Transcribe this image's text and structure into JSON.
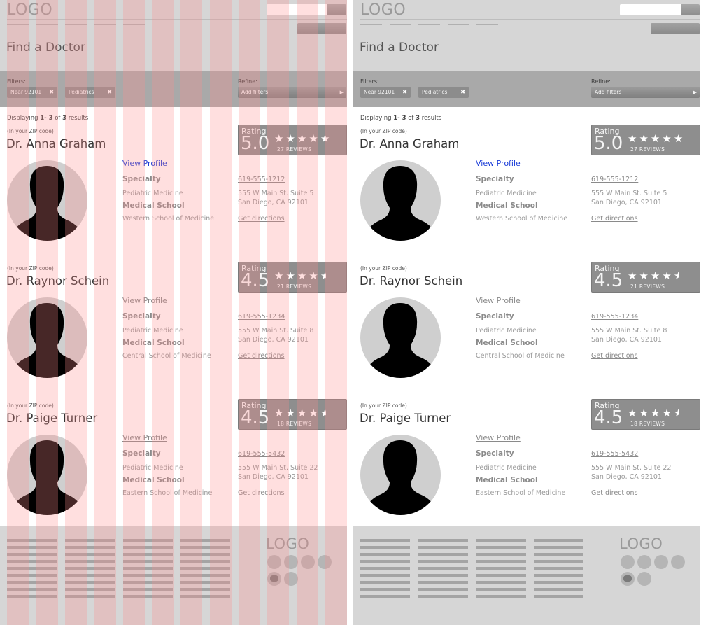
{
  "header": {
    "logo": "LOGO",
    "page_title": "Find a Doctor"
  },
  "filters": {
    "label": "Filters:",
    "chips": [
      {
        "label": "Near 92101",
        "remove": "✖"
      },
      {
        "label": "Pediatrics",
        "remove": "✖"
      }
    ],
    "refine_label": "Refine:",
    "add_filters": "Add filters"
  },
  "results_summary": {
    "prefix": "Displaying",
    "range": "1- 3",
    "of": "of",
    "total": "3",
    "suffix": "results"
  },
  "doctors": [
    {
      "zip_note": "(In your ZIP code)",
      "name": "Dr. Anna Graham",
      "view_profile": "View Profile",
      "specialty_label": "Specialty",
      "specialty": "Pediatric Medicine",
      "school_label": "Medical School",
      "school": "Western School of Medicine",
      "phone": "619-555-1212",
      "address_line1": "555 W Main St. Suite 5",
      "address_line2": "San Diego, CA 92101",
      "directions": "Get directions",
      "rating_label": "Rating",
      "rating": 5.0,
      "rating_text": "5.0",
      "reviews": "27 REVIEWS"
    },
    {
      "zip_note": "(In your ZIP code)",
      "name": "Dr. Raynor Schein",
      "view_profile": "View Profile",
      "specialty_label": "Specialty",
      "specialty": "Pediatric Medicine",
      "school_label": "Medical School",
      "school": "Central School of Medicine",
      "phone": "619-555-1234",
      "address_line1": "555 W Main St. Suite 8",
      "address_line2": "San Diego, CA 92101",
      "directions": "Get directions",
      "rating_label": "Rating",
      "rating": 4.5,
      "rating_text": "4.5",
      "reviews": "21 REVIEWS"
    },
    {
      "zip_note": "(In your ZIP code)",
      "name": "Dr. Paige Turner",
      "view_profile": "View Profile",
      "specialty_label": "Specialty",
      "specialty": "Pediatric Medicine",
      "school_label": "Medical School",
      "school": "Eastern School of Medicine",
      "phone": "619-555-5432",
      "address_line1": "555 W Main St. Suite 22",
      "address_line2": "San Diego, CA 92101",
      "directions": "Get directions",
      "rating_label": "Rating",
      "rating": 4.5,
      "rating_text": "4.5",
      "reviews": "18 REVIEWS"
    }
  ],
  "footer": {
    "logo": "LOGO"
  },
  "icons": {
    "star": "star-icon",
    "remove": "close-icon",
    "arrow": "chevron-right-icon",
    "avatar": "person-silhouette-icon",
    "chat": "chat-bubble-icon"
  },
  "colors": {
    "header_bg": "#d6d6d6",
    "filterbar_bg": "#a9a9a9",
    "rating_bg": "#8e8e8e",
    "link": "#1a3cd8",
    "grid_overlay": "#ff8c8c"
  }
}
